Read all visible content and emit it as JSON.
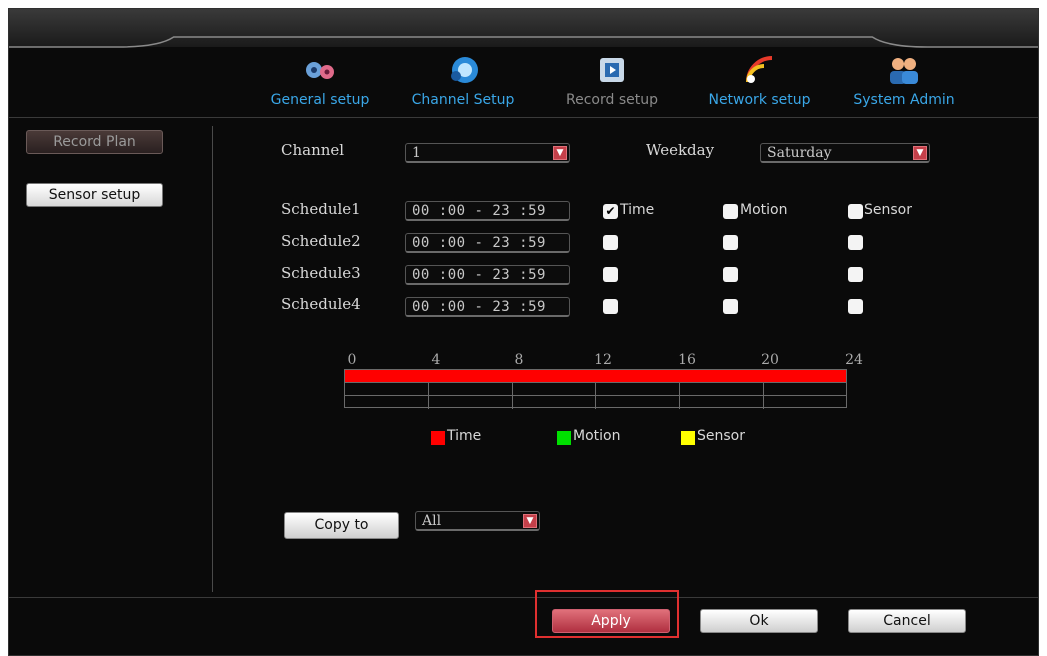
{
  "nav": [
    {
      "label": "General setup",
      "icon": "gears-icon",
      "active": true
    },
    {
      "label": "Channel Setup",
      "icon": "camera-icon",
      "active": true
    },
    {
      "label": "Record setup",
      "icon": "film-icon",
      "active": false
    },
    {
      "label": "Network setup",
      "icon": "wifi-icon",
      "active": true
    },
    {
      "label": "System Admin",
      "icon": "users-icon",
      "active": true
    }
  ],
  "sidebar": {
    "record_plan": "Record Plan",
    "sensor_setup": "Sensor setup"
  },
  "form": {
    "channel_label": "Channel",
    "channel_value": "1",
    "weekday_label": "Weekday",
    "weekday_value": "Saturday",
    "schedules": [
      {
        "label": "Schedule1",
        "time": "00 :00 - 23 :59",
        "time_checked": true,
        "motion_checked": false,
        "sensor_checked": false
      },
      {
        "label": "Schedule2",
        "time": "00 :00 - 23 :59",
        "time_checked": false,
        "motion_checked": false,
        "sensor_checked": false
      },
      {
        "label": "Schedule3",
        "time": "00 :00 - 23 :59",
        "time_checked": false,
        "motion_checked": false,
        "sensor_checked": false
      },
      {
        "label": "Schedule4",
        "time": "00 :00 - 23 :59",
        "time_checked": false,
        "motion_checked": false,
        "sensor_checked": false
      }
    ],
    "col_time": "Time",
    "col_motion": "Motion",
    "col_sensor": "Sensor"
  },
  "timeline": {
    "ticks": [
      "0",
      "4",
      "8",
      "12",
      "16",
      "20",
      "24"
    ],
    "time_fill_fraction": 1.0,
    "legend": [
      {
        "label": "Time",
        "color": "#ff0000"
      },
      {
        "label": "Motion",
        "color": "#00e000"
      },
      {
        "label": "Sensor",
        "color": "#ffff00"
      }
    ]
  },
  "copy": {
    "button": "Copy to",
    "value": "All"
  },
  "footer": {
    "apply": "Apply",
    "ok": "Ok",
    "cancel": "Cancel"
  },
  "colors": {
    "accent": "#3aa7e8",
    "record_bar": "#ff0000",
    "highlight": "#e03030"
  }
}
